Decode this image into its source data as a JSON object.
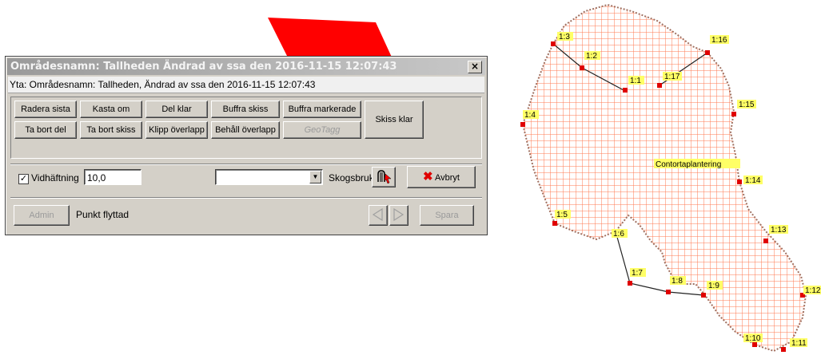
{
  "dialog": {
    "title": "Områdesnamn: Tallheden Ändrad av ssa den 2016-11-15 12:07:43",
    "close": "×",
    "info": "Yta: Områdesnamn: Tallheden, Ändrad av ssa den 2016-11-15 12:07:43",
    "toolbar": {
      "radera_sista": "Radera sista",
      "kasta_om": "Kasta om",
      "del_klar": "Del klar",
      "buffra_skiss": "Buffra skiss",
      "buffra_markerade": "Buffra markerade",
      "skiss_klar": "Skiss klar",
      "ta_bort_del": "Ta bort del",
      "ta_bort_skiss": "Ta bort skiss",
      "klipp_overlapp": "Klipp överlapp",
      "behall_overlapp": "Behåll överlapp",
      "geotagg": "GeoTagg"
    },
    "vidhaftning": {
      "label": "Vidhäftning",
      "checked": true,
      "check": "✓",
      "value": "10,0"
    },
    "dropdown": {
      "value": ""
    },
    "skogsbruk_label": "Skogsbruk",
    "avbryt_label": "Avbryt",
    "admin_label": "Admin",
    "status": "Punkt flyttad",
    "spara_label": "Spara"
  },
  "map": {
    "area_label": "Contortaplantering",
    "accent_fill": "#ff0000",
    "hatch_color": "#ff7a50",
    "points": [
      "1:1",
      "1:2",
      "1:3",
      "1:4",
      "1:5",
      "1:6",
      "1:7",
      "1:8",
      "1:9",
      "1:10",
      "1:11",
      "1:12",
      "1:13",
      "1:14",
      "1:15",
      "1:16",
      "1:17"
    ]
  }
}
